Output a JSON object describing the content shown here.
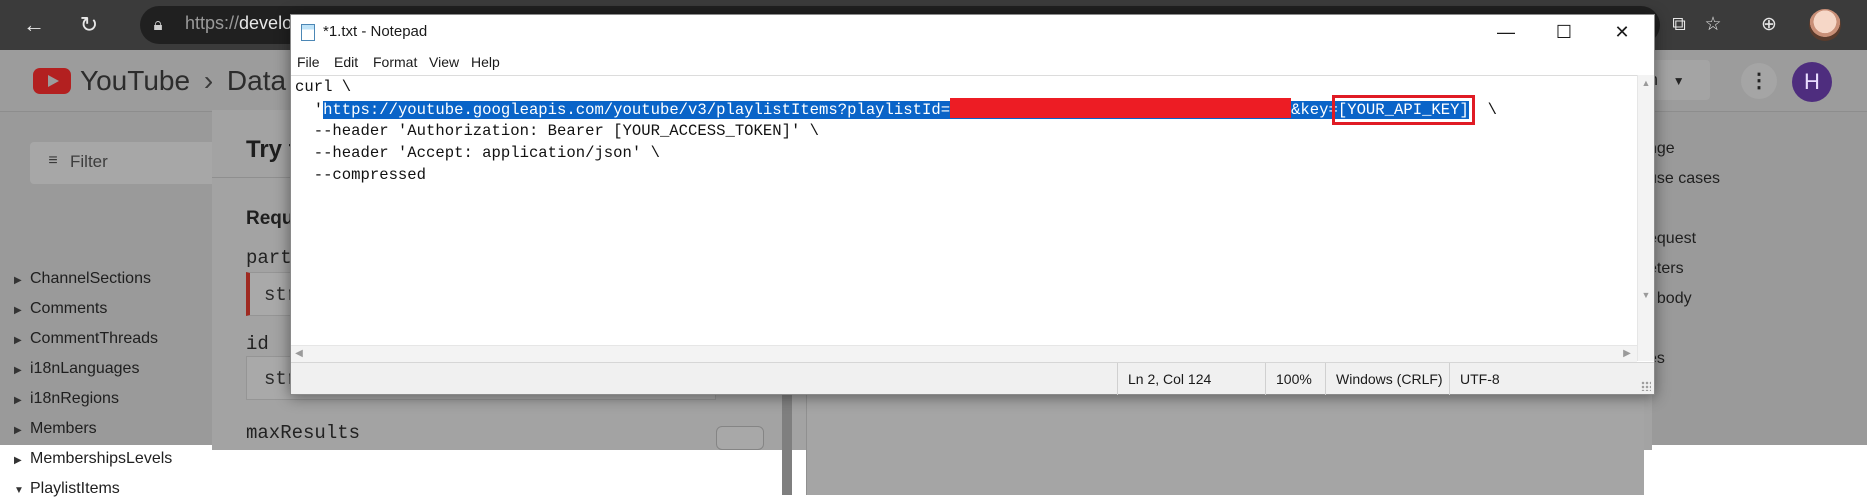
{
  "browser": {
    "url_prefix": "https://",
    "url_host": "develo",
    "icons": [
      "back-icon",
      "reload-icon",
      "lock-icon",
      "extensions-icon",
      "favorites-icon",
      "collections-icon",
      "profile-avatar"
    ]
  },
  "docs_page": {
    "logo_text": "YouTube",
    "breadcrumb_sep": "›",
    "breadcrumb": "Data",
    "language_label": "sh",
    "more_label": "⋮",
    "user_initial": "H",
    "filter_placeholder": "Filter",
    "sidebar_items": [
      "ChannelSections",
      "Comments",
      "CommentThreads",
      "i18nLanguages",
      "i18nRegions",
      "Members",
      "MembershipsLevels",
      "PlaylistItems"
    ],
    "dialog_title": "Try t",
    "request_heading": "Requ",
    "params": [
      {
        "label": "part",
        "value": "str"
      },
      {
        "label": "id",
        "value": "str"
      },
      {
        "label": "maxResults",
        "value": ""
      }
    ],
    "right_nav_items": [
      "nge",
      "use cases",
      "equest",
      "eters",
      "t body",
      "es"
    ]
  },
  "notepad": {
    "title": "*1.txt - Notepad",
    "menu": [
      "File",
      "Edit",
      "Format",
      "View",
      "Help"
    ],
    "window_buttons": {
      "minimize": "—",
      "maximize": "☐",
      "close": "✕"
    },
    "lines": {
      "line1": "curl \\",
      "line2_prefix": "  '",
      "line2_selected_url": "https://youtube.googleapis.com/youtube/v3/playlistItems?playlistId=",
      "line2_key_param": "&key=",
      "line2_api_key": "[YOUR_API_KEY]",
      "line2_suffix": "' \\",
      "line3": "  --header 'Authorization: Bearer [YOUR_ACCESS_TOKEN]' \\",
      "line4": "  --header 'Accept: application/json' \\",
      "line5": "  --compressed"
    },
    "status": {
      "position": "Ln 2, Col 124",
      "zoom": "100%",
      "line_ending": "Windows (CRLF)",
      "encoding": "UTF-8"
    }
  },
  "colors": {
    "selection": "#0a64c8",
    "redaction": "#ed1c24",
    "highlight_box": "#e01b24"
  }
}
